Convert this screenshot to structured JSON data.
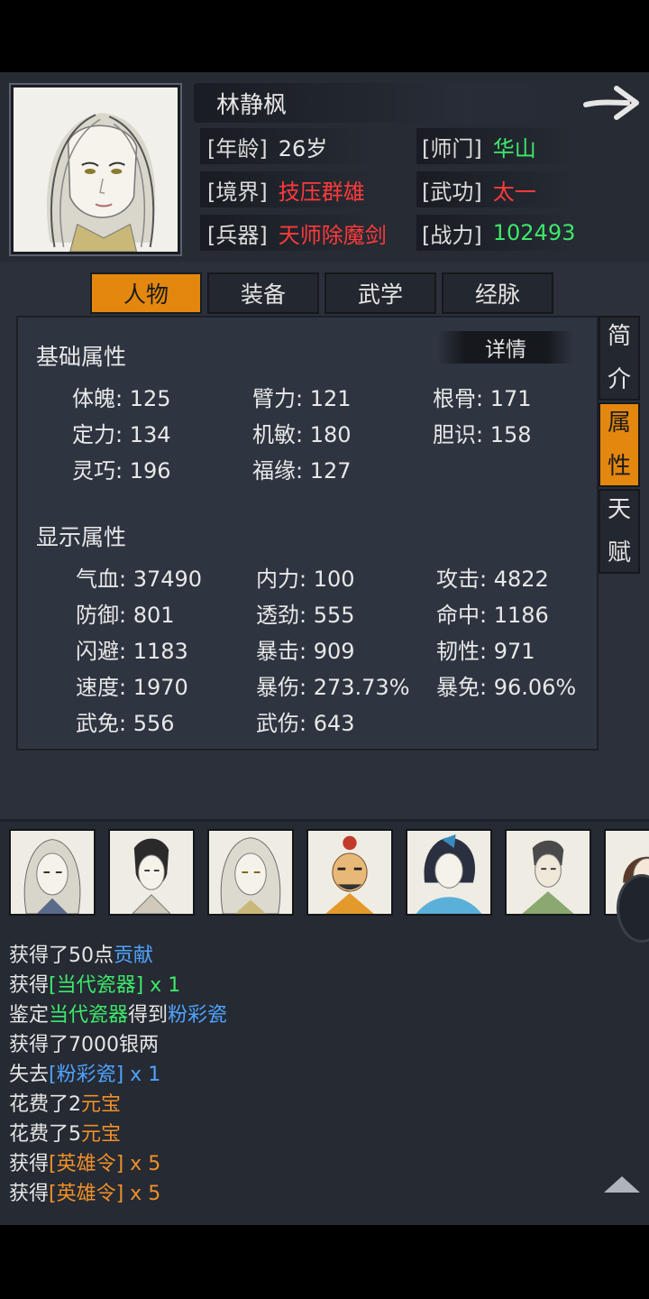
{
  "character": {
    "name": "林静枫",
    "age_label": "[年龄]",
    "age_value": "26岁",
    "sect_label": "[师门]",
    "sect_value": "华山",
    "realm_label": "[境界]",
    "realm_value": "技压群雄",
    "martial_label": "[武功]",
    "martial_value": "太一",
    "weapon_label": "[兵器]",
    "weapon_value": "天师除魔剑",
    "power_label": "[战力]",
    "power_value": "102493"
  },
  "tabs": [
    "人物",
    "装备",
    "武学",
    "经脉"
  ],
  "side_tabs": [
    {
      "chars": [
        "简",
        "介"
      ]
    },
    {
      "chars": [
        "属",
        "性"
      ]
    },
    {
      "chars": [
        "天",
        "赋"
      ]
    }
  ],
  "panel": {
    "basic_title": "基础属性",
    "detail_label": "详情",
    "basic_stats": [
      "体魄: 125",
      "臂力: 121",
      "根骨: 171",
      "定力: 134",
      "机敏: 180",
      "胆识: 158",
      "灵巧: 196",
      "福缘: 127"
    ],
    "display_title": "显示属性",
    "display_stats": [
      "气血: 37490",
      "内力: 100",
      "攻击: 4822",
      "防御: 801",
      "透劲: 555",
      "命中: 1186",
      "闪避: 1183",
      "暴击: 909",
      "韧性: 971",
      "速度: 1970",
      "暴伤: 273.73%",
      "暴免: 96.06%",
      "武免: 556",
      "武伤: 643"
    ]
  },
  "log": [
    {
      "parts": [
        {
          "t": "获得了50点",
          "c": "white"
        },
        {
          "t": "贡献",
          "c": "blue"
        }
      ]
    },
    {
      "parts": [
        {
          "t": "获得",
          "c": "white"
        },
        {
          "t": "[当代瓷器]",
          "c": "green"
        },
        {
          "t": " x 1",
          "c": "green"
        }
      ]
    },
    {
      "parts": [
        {
          "t": "鉴定",
          "c": "white"
        },
        {
          "t": "当代瓷器",
          "c": "green"
        },
        {
          "t": "得到",
          "c": "white"
        },
        {
          "t": "粉彩瓷",
          "c": "blue"
        }
      ]
    },
    {
      "parts": [
        {
          "t": "获得了7000银两",
          "c": "white"
        }
      ]
    },
    {
      "parts": [
        {
          "t": "失去",
          "c": "white"
        },
        {
          "t": "[粉彩瓷]",
          "c": "blue"
        },
        {
          "t": " x 1",
          "c": "blue"
        }
      ]
    },
    {
      "parts": [
        {
          "t": "花费了2",
          "c": "white"
        },
        {
          "t": "元宝",
          "c": "orange"
        }
      ]
    },
    {
      "parts": [
        {
          "t": "花费了5",
          "c": "white"
        },
        {
          "t": "元宝",
          "c": "orange"
        }
      ]
    },
    {
      "parts": [
        {
          "t": "获得",
          "c": "white"
        },
        {
          "t": "[英雄令]",
          "c": "orange"
        },
        {
          "t": " x 5",
          "c": "orange"
        }
      ]
    },
    {
      "parts": [
        {
          "t": "获得",
          "c": "white"
        },
        {
          "t": "[英雄令]",
          "c": "orange"
        },
        {
          "t": " x 5",
          "c": "orange"
        }
      ]
    }
  ],
  "icons": {
    "next": "arrow-right-icon",
    "scroll": "triangle-up-icon"
  }
}
